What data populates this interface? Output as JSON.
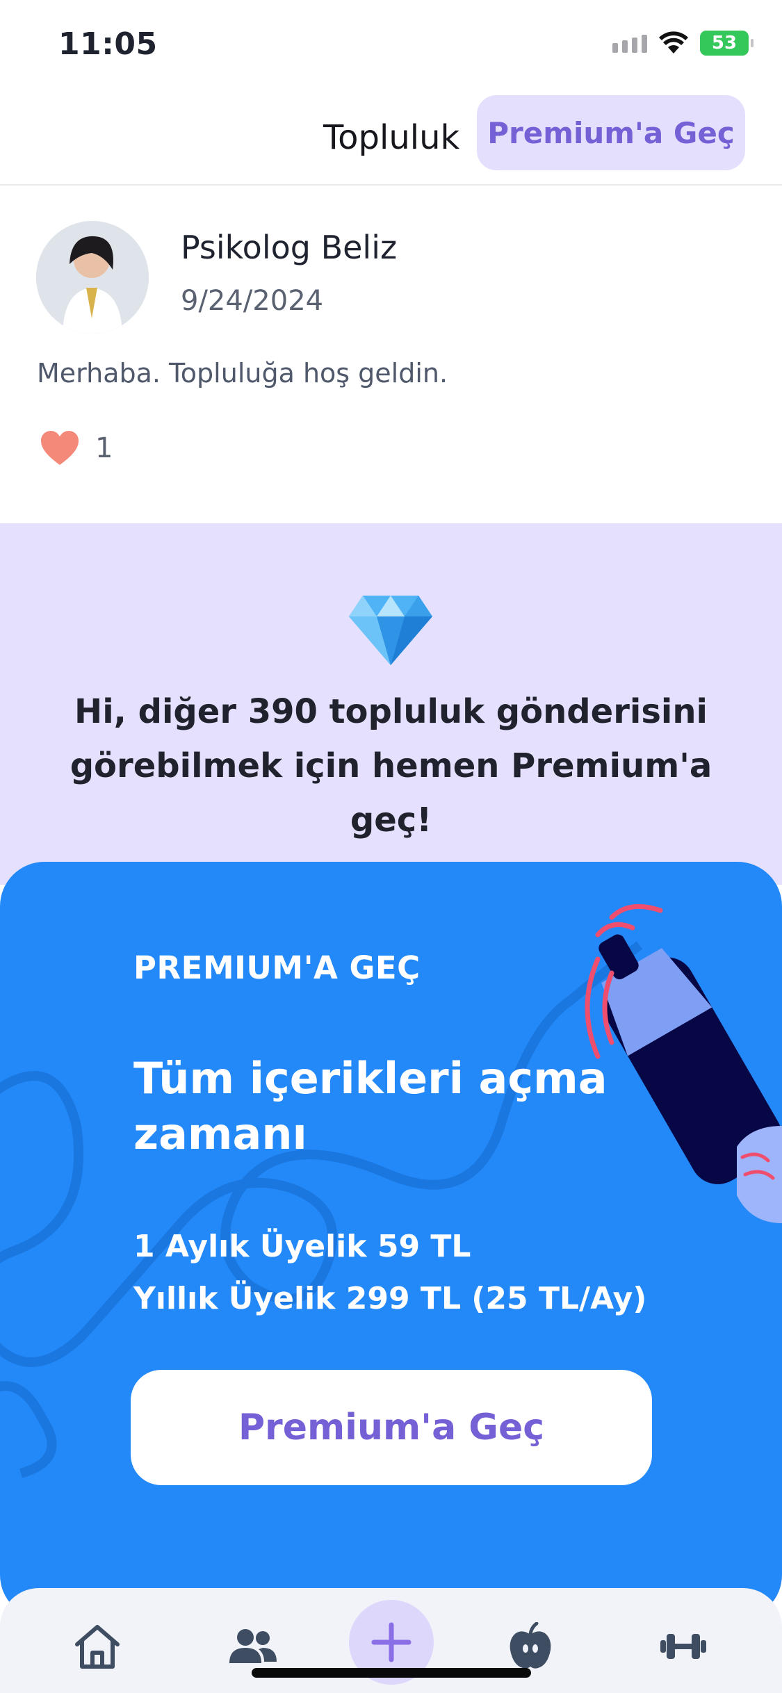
{
  "status_bar": {
    "time": "11:05",
    "battery": "53"
  },
  "header": {
    "title": "Topluluk",
    "premium_button": "Premium'a Geç"
  },
  "post": {
    "author": "Psikolog Beliz",
    "date": "9/24/2024",
    "message": "Merhaba. Topluluğa hoş geldin.",
    "like_count": "1"
  },
  "teaser": {
    "line1": "Hi, diğer 390 topluluk gönderisini",
    "line2": "görebilmek için hemen Premium'a geç!"
  },
  "promo": {
    "eyebrow": "PREMIUM'A GEÇ",
    "headline": "Tüm içerikleri açma zamanı",
    "price_monthly": "1 Aylık Üyelik 59 TL",
    "price_yearly": "Yıllık Üyelik 299 TL (25 TL/Ay)",
    "cta": "Premium'a Geç"
  },
  "tabbar": {
    "items": [
      "home-icon",
      "community-icon",
      "add-icon",
      "nutrition-icon",
      "fitness-icon"
    ],
    "accent": "#7560d6"
  },
  "colors": {
    "brand_blue": "#2389f8",
    "lavender": "#e4e0fd",
    "purple": "#7560d6",
    "heart": "#f4897a"
  }
}
